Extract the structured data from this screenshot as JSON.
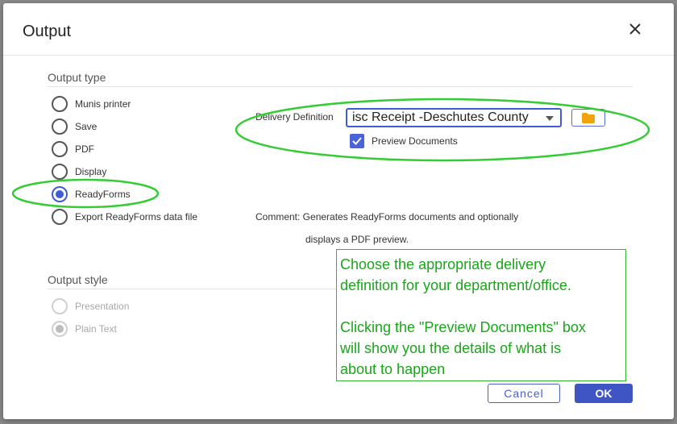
{
  "dialog": {
    "title": "Output",
    "close_icon": "close-icon"
  },
  "output_type": {
    "label": "Output type",
    "options": [
      {
        "label": "Munis printer",
        "checked": false
      },
      {
        "label": "Save",
        "checked": false
      },
      {
        "label": "PDF",
        "checked": false
      },
      {
        "label": "Display",
        "checked": false
      },
      {
        "label": "ReadyForms",
        "checked": true
      },
      {
        "label": "Export ReadyForms data file",
        "checked": false
      }
    ]
  },
  "delivery": {
    "label": "Delivery Definition",
    "selected": "isc Receipt -Deschutes County",
    "folder_icon": "folder-icon",
    "preview_label": "Preview Documents",
    "preview_checked": true
  },
  "comment": {
    "line1": "Comment: Generates ReadyForms documents and optionally",
    "line2": "displays a PDF preview."
  },
  "output_style": {
    "label": "Output style",
    "options": [
      {
        "label": "Presentation",
        "checked": false,
        "disabled": true
      },
      {
        "label": "Plain Text",
        "checked": true,
        "disabled": true
      }
    ]
  },
  "callout": {
    "line1": "Choose the appropriate delivery",
    "line2": "definition for your department/office.",
    "line3": "Clicking the \"Preview Documents\" box",
    "line4": "will show you the details of what is",
    "line5": "about to happen"
  },
  "buttons": {
    "cancel": "Cancel",
    "ok": "OK"
  },
  "colors": {
    "accent": "#3f5bd6",
    "annotation_green": "#33cc33",
    "folder": "#f0a30a"
  }
}
